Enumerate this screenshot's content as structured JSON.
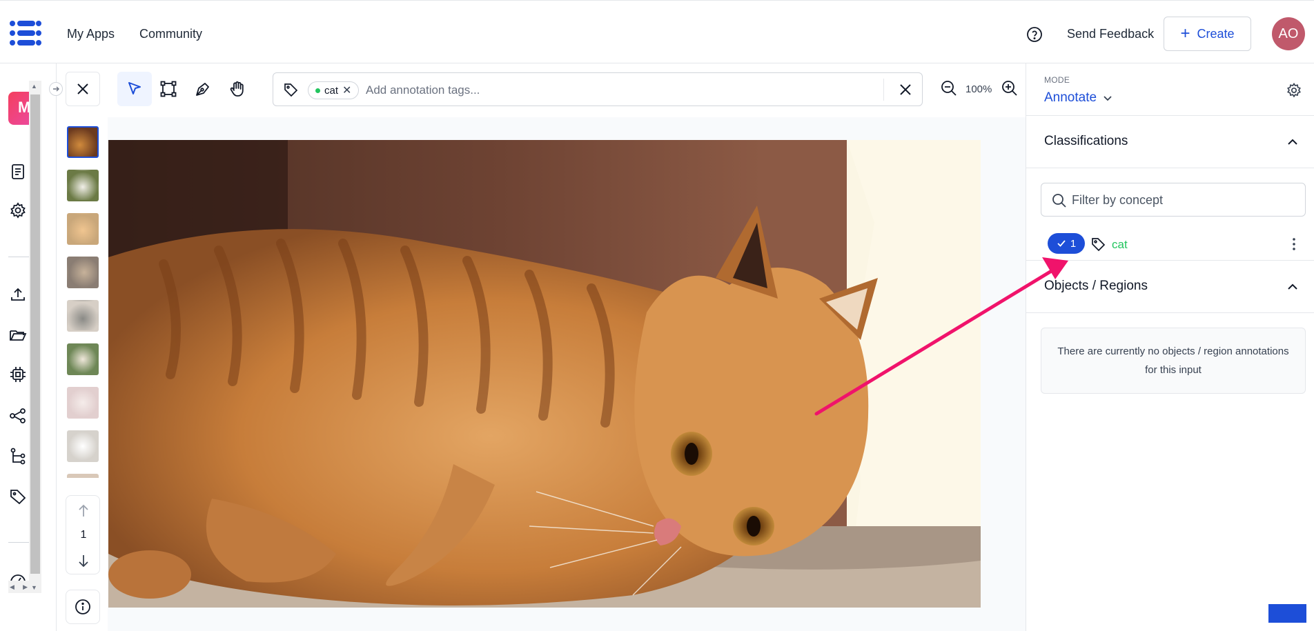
{
  "header": {
    "logo_icon": "clarifai-logo-icon",
    "nav": [
      "My Apps",
      "Community"
    ],
    "help_icon": "question-circle-icon",
    "send_feedback": "Send Feedback",
    "create_label": "Create",
    "avatar_initials": "AO"
  },
  "sidebar": {
    "app_initial": "M",
    "icons": [
      "document-icon",
      "gear-icon",
      "upload-icon",
      "folder-open-icon",
      "cpu-chip-icon",
      "share-nodes-icon",
      "workflow-icon",
      "tag-icon",
      "dashboard-icon"
    ]
  },
  "toolbar": {
    "tools": [
      "select-pointer-tool",
      "bounding-box-tool",
      "polygon-pen-tool",
      "pan-hand-tool"
    ],
    "active_tool": "select-pointer-tool",
    "tags": [
      {
        "label": "cat",
        "color": "#22c55e"
      }
    ],
    "tag_placeholder": "Add annotation tags...",
    "zoom_level": "100%"
  },
  "thumbnails": {
    "count_visible": 8,
    "selected_index": 0,
    "page_number": "1"
  },
  "right_panel": {
    "mode_label": "MODE",
    "mode_value": "Annotate",
    "classifications": {
      "title": "Classifications",
      "filter_placeholder": "Filter by concept",
      "concepts": [
        {
          "count": "1",
          "name": "cat",
          "color": "#22c55e"
        }
      ]
    },
    "objects_regions": {
      "title": "Objects / Regions",
      "empty_text": "There are currently no objects / region annotations for this input"
    }
  },
  "colors": {
    "accent": "#1d4ed8",
    "annotation_arrow": "#f0136b",
    "avatar": "#c0596b"
  }
}
